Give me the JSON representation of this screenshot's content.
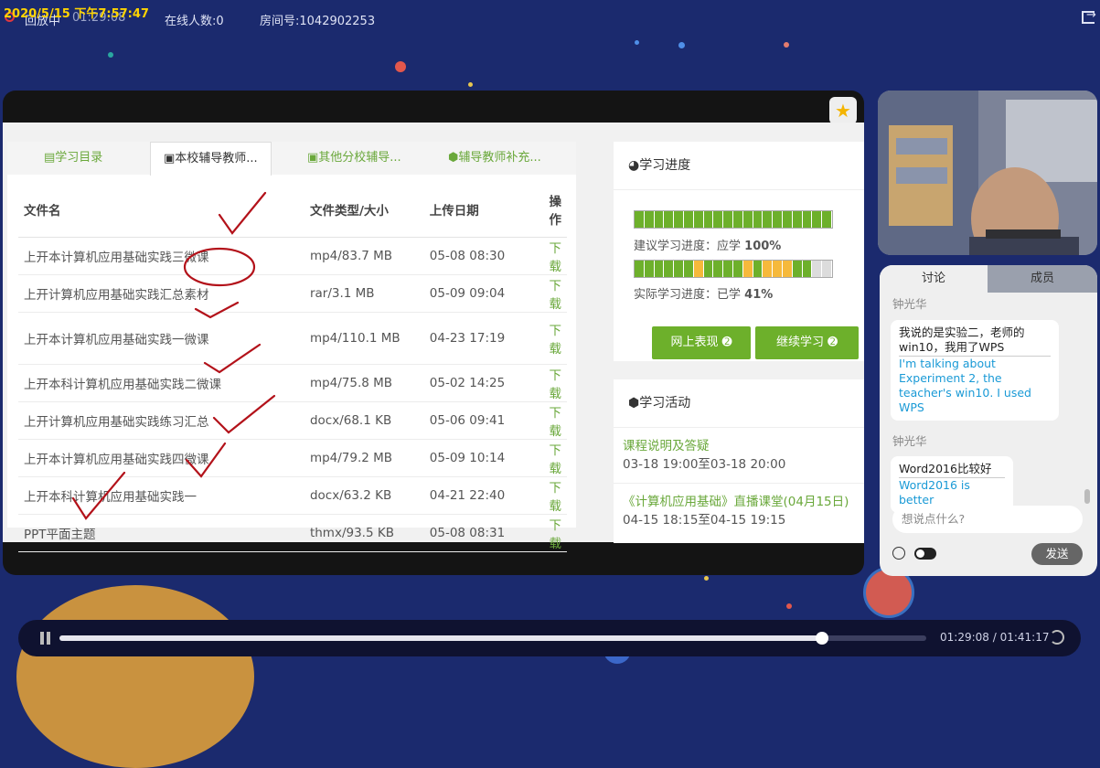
{
  "status": {
    "datetime_overlay": "2020/5/15 下午7:57:47",
    "mode": "回放中",
    "elapsed": "01:29:08",
    "online_count": "在线人数:0",
    "room_no": "房间号:1042902253"
  },
  "course_panel": {
    "tabs": [
      "学习目录",
      "本校辅导教师...",
      "其他分校辅导...",
      "辅导教师补充..."
    ],
    "active_tab": 1,
    "columns": [
      "文件名",
      "文件类型/大小",
      "上传日期",
      "操作"
    ],
    "files": [
      {
        "name": "上开本计算机应用基础实践三微课",
        "type": "mp4/83.7 MB",
        "date": "05-08 08:30",
        "action": "下载"
      },
      {
        "name": "上开计算机应用基础实践汇总素材",
        "type": "rar/3.1 MB",
        "date": "05-09 09:04",
        "action": "下载"
      },
      {
        "name": "上开本计算机应用基础实践一微课",
        "type": "mp4/110.1 MB",
        "date": "04-23 17:19",
        "action": "下载"
      },
      {
        "name": "上开本科计算机应用基础实践二微课",
        "type": "mp4/75.8 MB",
        "date": "05-02 14:25",
        "action": "下载"
      },
      {
        "name": "上开计算机应用基础实践练习汇总",
        "type": "docx/68.1 KB",
        "date": "05-06 09:41",
        "action": "下载"
      },
      {
        "name": "上开本计算机应用基础实践四微课",
        "type": "mp4/79.2 MB",
        "date": "05-09 10:14",
        "action": "下载"
      },
      {
        "name": "上开本科计算机应用基础实践一",
        "type": "docx/63.2 KB",
        "date": "04-21 22:40",
        "action": "下载"
      },
      {
        "name": "PPT平面主题",
        "type": "thmx/93.5 KB",
        "date": "05-08 08:31",
        "action": "下载"
      }
    ]
  },
  "progress": {
    "title": "学习进度",
    "suggested_label": "建议学习进度：应学",
    "suggested_value": "100%",
    "actual_label": "实际学习进度：已学",
    "actual_value": "41%",
    "suggested_fraction": 1.0,
    "actual_fraction": 0.41,
    "buttons": [
      "网上表现",
      "继续学习"
    ]
  },
  "activities": {
    "title": "学习活动",
    "items": [
      {
        "title": "课程说明及答疑",
        "time": "03-18 19:00至03-18 20:00"
      },
      {
        "title": "《计算机应用基础》直播课堂(04月15日)",
        "time": "04-15 18:15至04-15 19:15"
      }
    ]
  },
  "chat": {
    "tabs": [
      "讨论",
      "成员"
    ],
    "messages": [
      {
        "user": "钟光华",
        "text": "我说的是实验二，老师的win10，我用了WPS",
        "translation": "I'm talking about Experiment 2, the teacher's win10. I used WPS"
      },
      {
        "user": "钟光华",
        "text": "Word2016比较好",
        "translation": "Word2016 is better"
      }
    ],
    "input_placeholder": "想说点什么?",
    "send_label": "发送"
  },
  "player": {
    "current": "01:29:08",
    "total": "01:41:17",
    "time_text": "01:29:08 / 01:41:17",
    "progress_fraction": 0.88
  },
  "colors": {
    "background": "#1b2a6e",
    "accent_green": "#6db02b",
    "link_green": "#6aa83b",
    "translation_blue": "#1a9ad6",
    "record_red": "#e2383f",
    "overlay_yellow": "#ffd400"
  },
  "icons": [
    "record-icon",
    "exit-icon",
    "star-badge-icon",
    "pie-chart-icon",
    "cube-icon",
    "smile-icon",
    "translate-toggle-icon",
    "pause-icon",
    "loop-icon"
  ]
}
